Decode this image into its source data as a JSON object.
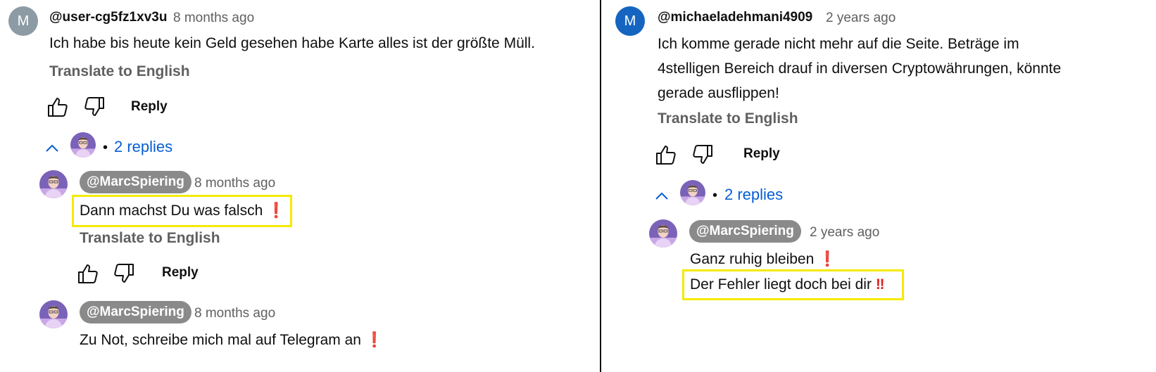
{
  "left": {
    "comment": {
      "avatar_letter": "M",
      "author": "@user-cg5fz1xv3u",
      "time": "8 months ago",
      "text": "Ich habe bis heute kein Geld gesehen habe Karte alles ist der größte Müll.",
      "translate": "Translate to English",
      "reply": "Reply"
    },
    "replies_toggle": "2 replies",
    "replies": [
      {
        "author": "@MarcSpiering",
        "time": "8 months ago",
        "text": "Dann machst Du was falsch",
        "emoji": "❗",
        "translate": "Translate to English",
        "reply": "Reply"
      },
      {
        "author": "@MarcSpiering",
        "time": "8 months ago",
        "text": "Zu Not, schreibe mich mal auf Telegram an",
        "emoji": "❗"
      }
    ]
  },
  "right": {
    "comment": {
      "avatar_letter": "M",
      "author": "@michaeladehmani4909",
      "time": "2 years ago",
      "text_lines": [
        "Ich komme gerade nicht mehr auf die Seite. Beträge im",
        "4stelligen Bereich drauf in diversen Cryptowährungen, könnte",
        "gerade ausflippen!"
      ],
      "translate": "Translate to English",
      "reply": "Reply"
    },
    "replies_toggle": "2 replies",
    "replies": [
      {
        "author": "@MarcSpiering",
        "time": "2 years ago",
        "line1": "Ganz ruhig bleiben",
        "line1_emoji": "❗",
        "line2": "Der Fehler liegt doch bei dir",
        "line2_emoji": "‼"
      }
    ]
  },
  "icons": {
    "like": "thumbs-up-icon",
    "dislike": "thumbs-down-icon",
    "collapse": "chevron-up-icon"
  },
  "colors": {
    "link_blue": "#065fd4",
    "highlight": "#f5ea00",
    "avatar_gray": "#8d9ba5",
    "avatar_blue": "#1565c0",
    "pill_gray": "#8a8a8a"
  }
}
